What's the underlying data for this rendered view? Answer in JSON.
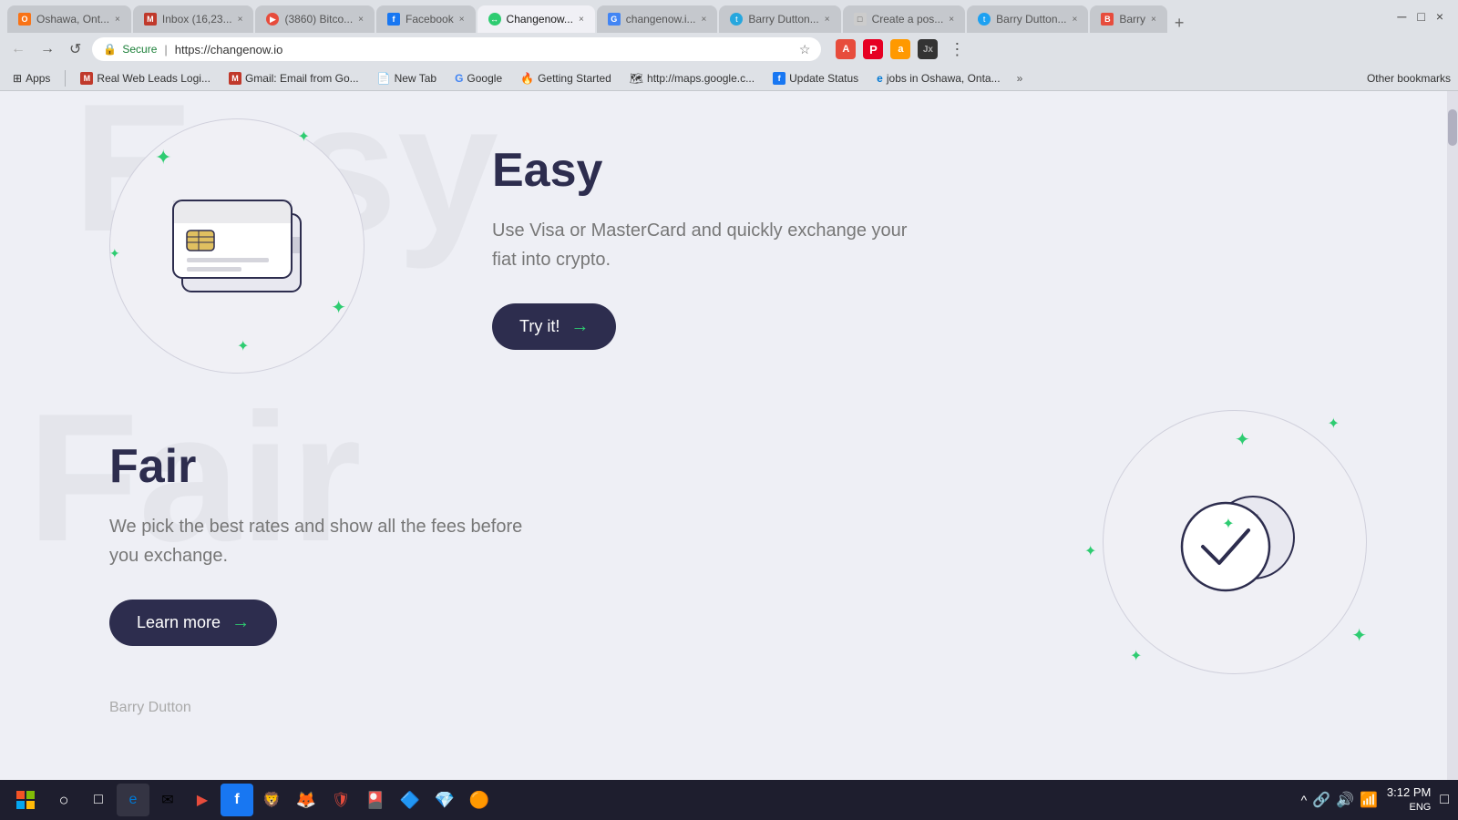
{
  "browser": {
    "tabs": [
      {
        "label": "Oshawa, Ont...",
        "favicon_color": "#f97316",
        "active": false
      },
      {
        "label": "Inbox (16,23...",
        "favicon_color": "#c0392b",
        "active": false
      },
      {
        "label": "(3860) Bitco...",
        "favicon_color": "#e74c3c",
        "active": false
      },
      {
        "label": "Facebook",
        "favicon_color": "#1877f2",
        "active": false
      },
      {
        "label": "Changenow...",
        "favicon_color": "#2ecc71",
        "active": true
      },
      {
        "label": "changenow.i...",
        "favicon_color": "#4285f4",
        "active": false
      },
      {
        "label": "Barry Dutton...",
        "favicon_color": "#26a7de",
        "active": false
      },
      {
        "label": "Create a pos...",
        "favicon_color": "#ccc",
        "active": false
      },
      {
        "label": "Barry Dutton...",
        "favicon_color": "#1da1f2",
        "active": false
      },
      {
        "label": "Barry",
        "favicon_color": "#e74c3c",
        "active": false
      }
    ],
    "address": "https://changenow.io",
    "secure_label": "Secure",
    "url_display": "https://changenow.io"
  },
  "bookmarks": [
    {
      "label": "Apps",
      "icon": "⊞"
    },
    {
      "label": "Real Web Leads Logi...",
      "icon": "M"
    },
    {
      "label": "Gmail: Email from Go...",
      "icon": "M"
    },
    {
      "label": "New Tab",
      "icon": "☆"
    },
    {
      "label": "Google",
      "icon": "G"
    },
    {
      "label": "Getting Started",
      "icon": "🔥"
    },
    {
      "label": "http://maps.google.c...",
      "icon": "M"
    },
    {
      "label": "Update Status",
      "icon": "f"
    },
    {
      "label": "jobs in Oshawa, Onta...",
      "icon": "e"
    }
  ],
  "other_bookmarks_label": "Other bookmarks",
  "page": {
    "section_easy": {
      "watermark": "Easy",
      "title": "Easy",
      "description": "Use Visa or MasterCard and quickly exchange your fiat into crypto.",
      "button_label": "Try it!"
    },
    "section_fair": {
      "watermark": "Fair",
      "title": "Fair",
      "description": "We pick the best rates and show all the fees before you exchange.",
      "button_label": "Learn more"
    }
  },
  "taskbar": {
    "time": "3:12 PM",
    "date": "ENG",
    "icons": [
      "⊞",
      "○",
      "□",
      "e",
      "✉",
      "▶",
      "f",
      "🔵",
      "🦊",
      "🛡",
      "🎴",
      "🔷",
      "💎",
      "🟠"
    ]
  }
}
